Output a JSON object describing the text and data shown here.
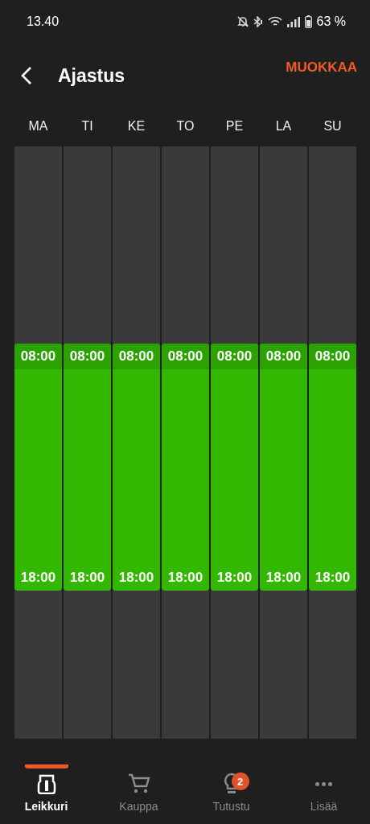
{
  "status_bar": {
    "time": "13.40",
    "battery": "63 %"
  },
  "header": {
    "title": "Ajastus",
    "action": "MUOKKAA"
  },
  "days": [
    {
      "label": "MA",
      "start": "08:00",
      "end": "18:00"
    },
    {
      "label": "TI",
      "start": "08:00",
      "end": "18:00"
    },
    {
      "label": "KE",
      "start": "08:00",
      "end": "18:00"
    },
    {
      "label": "TO",
      "start": "08:00",
      "end": "18:00"
    },
    {
      "label": "PE",
      "start": "08:00",
      "end": "18:00"
    },
    {
      "label": "LA",
      "start": "08:00",
      "end": "18:00"
    },
    {
      "label": "SU",
      "start": "08:00",
      "end": "18:00"
    }
  ],
  "nav": [
    {
      "kind": "mower",
      "label": "Leikkuri",
      "selected": true
    },
    {
      "kind": "cart",
      "label": "Kauppa",
      "selected": false
    },
    {
      "kind": "bulb",
      "label": "Tutustu",
      "selected": false,
      "badge": "2"
    },
    {
      "kind": "more",
      "label": "Lisää",
      "selected": false
    }
  ]
}
